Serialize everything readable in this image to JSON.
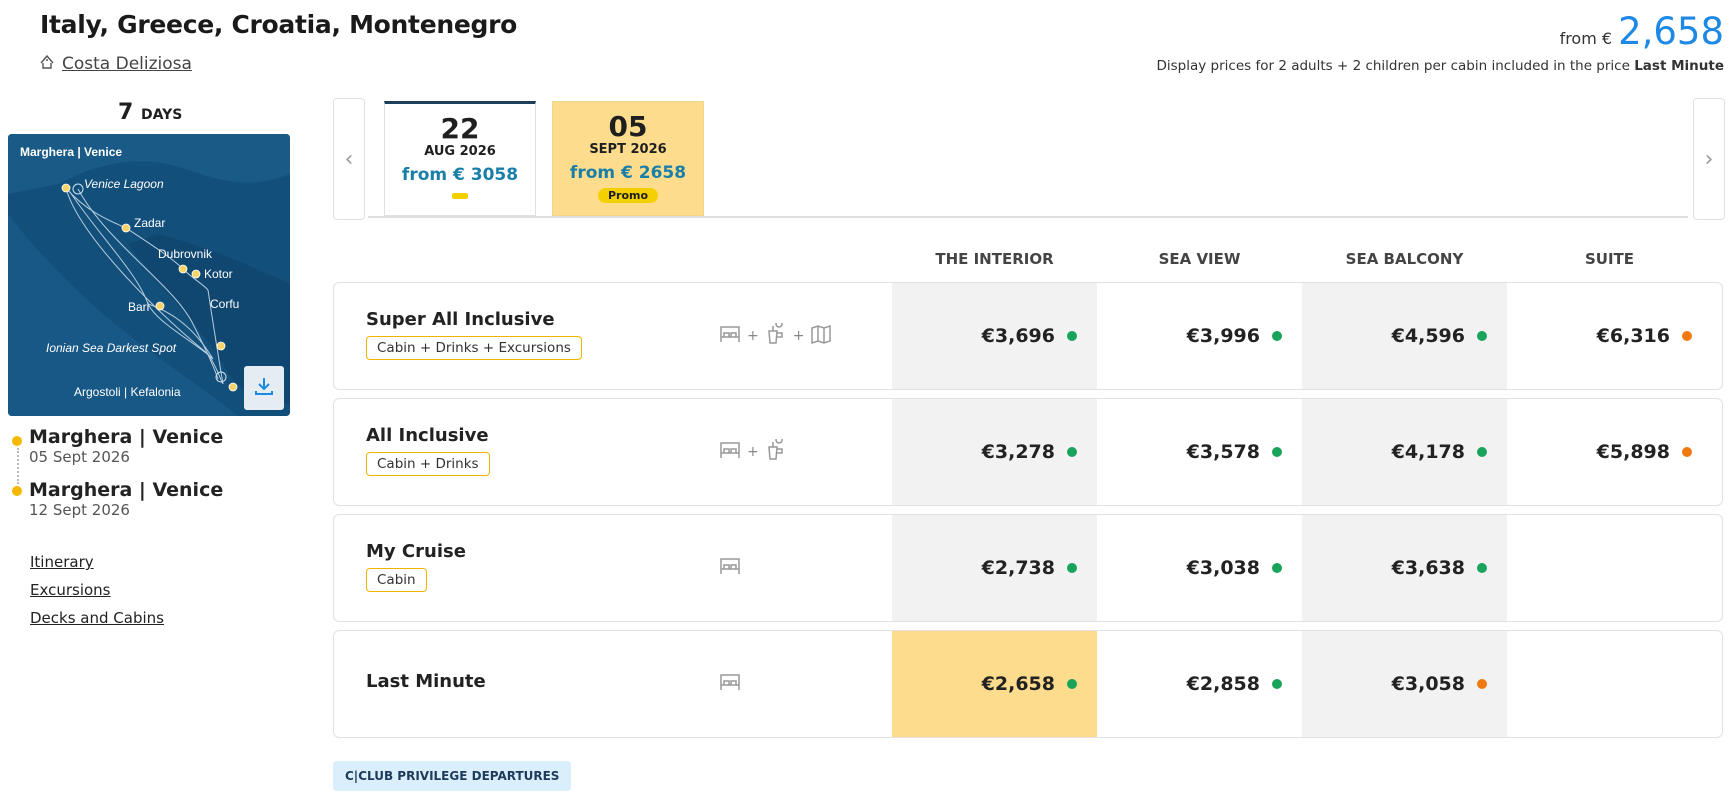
{
  "header": {
    "title": "Italy, Greece, Croatia, Montenegro",
    "ship": "Costa Deliziosa",
    "from_label": "from €",
    "from_price": "2,658",
    "display_note": "Display prices for 2 adults + 2 children per cabin included in the price",
    "display_note_bold": "Last Minute"
  },
  "itinerary": {
    "days_number": "7",
    "days_label": "DAYS",
    "map_labels": [
      "Marghera | Venice",
      "Venice Lagoon",
      "Zadar",
      "Dubrovnik",
      "Kotor",
      "Bari",
      "Corfu",
      "Ionian Sea Darkest Spot",
      "Argostoli | Kefalonia"
    ],
    "departure": {
      "port": "Marghera | Venice",
      "date": "05 Sept 2026"
    },
    "arrival": {
      "port": "Marghera | Venice",
      "date": "12 Sept 2026"
    },
    "links": [
      "Itinerary",
      "Excursions",
      "Decks and Cabins"
    ]
  },
  "dates": [
    {
      "day": "22",
      "month": "AUG 2026",
      "price": "from € 3058",
      "badge": ""
    },
    {
      "day": "05",
      "month": "SEPT 2026",
      "price": "from € 2658",
      "badge": "Promo"
    }
  ],
  "columns": [
    "THE INTERIOR",
    "SEA VIEW",
    "SEA BALCONY",
    "SUITE"
  ],
  "rows": [
    {
      "name": "Super All Inclusive",
      "tag": "Cabin + Drinks + Excursions",
      "prices": [
        "€3,696",
        "€3,996",
        "€4,596",
        "€6,316"
      ],
      "dots": [
        "green",
        "green",
        "green",
        "orange"
      ]
    },
    {
      "name": "All Inclusive",
      "tag": "Cabin + Drinks",
      "prices": [
        "€3,278",
        "€3,578",
        "€4,178",
        "€5,898"
      ],
      "dots": [
        "green",
        "green",
        "green",
        "orange"
      ]
    },
    {
      "name": "My Cruise",
      "tag": "Cabin",
      "prices": [
        "€2,738",
        "€3,038",
        "€3,638",
        ""
      ],
      "dots": [
        "green",
        "green",
        "green",
        ""
      ]
    },
    {
      "name": "Last Minute",
      "tag": "",
      "prices": [
        "€2,658",
        "€2,858",
        "€3,058",
        ""
      ],
      "dots": [
        "green",
        "green",
        "orange",
        ""
      ]
    }
  ],
  "club_button": "C|CLUB PRIVILEGE DEPARTURES",
  "colors": {
    "accent": "#1e88e5",
    "yellow": "#fddd8d",
    "green": "#1aa35a",
    "orange": "#f07a10",
    "tag_border": "#f0b400"
  }
}
